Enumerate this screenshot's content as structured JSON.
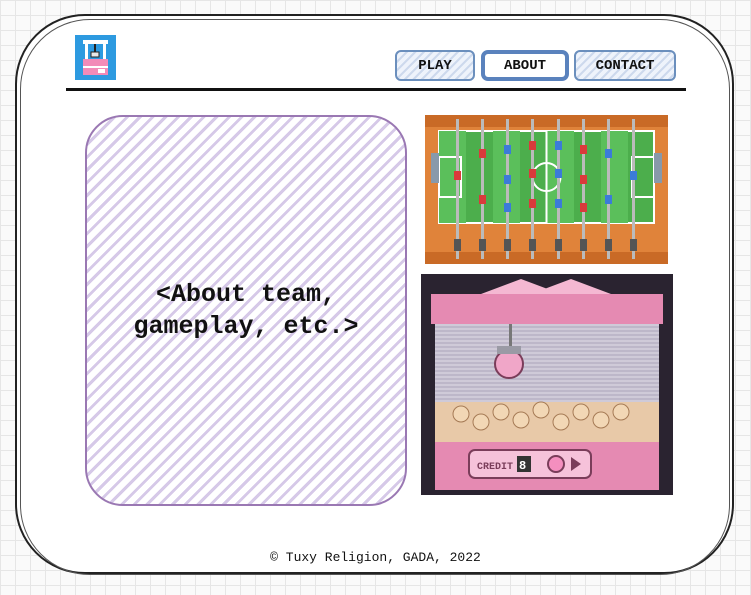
{
  "nav": {
    "play_label": "PLAY",
    "about_label": "ABOUT",
    "contact_label": "CONTACT",
    "active": "ABOUT"
  },
  "about": {
    "placeholder": "<About team,\ngameplay, etc.>"
  },
  "images": {
    "logo_icon": "claw-machine-logo-icon",
    "foosball": "foosball-table-image",
    "claw_machine": "claw-machine-pixel-art-image",
    "claw_credit_label": "CREDIT",
    "claw_credit_value": "8"
  },
  "footer": {
    "copyright": "© Tuxy Religion, GADA, 2022"
  },
  "colors": {
    "nav_border": "#6b8fbd",
    "about_border": "#9a78b3",
    "logo_bg": "#2d9ae0",
    "field_green": "#4cae4c",
    "table_orange": "#e0833a",
    "claw_pink": "#e58ab2"
  }
}
